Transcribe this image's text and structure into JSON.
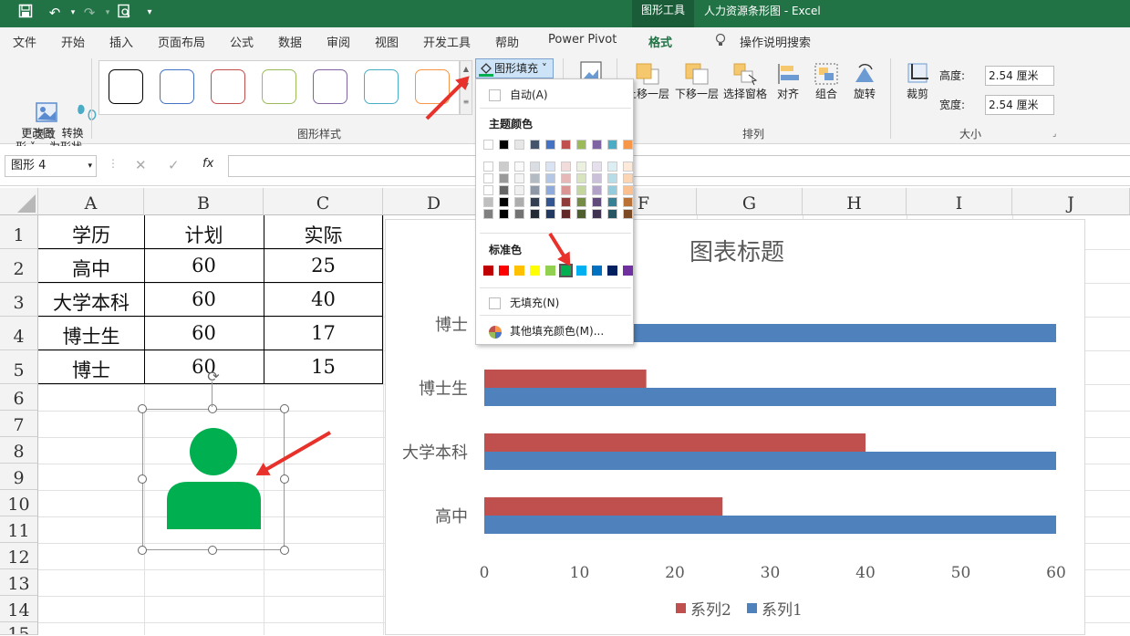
{
  "title_bar": {
    "contextual_tab": "图形工具",
    "document_title": "人力资源条形图 - Excel"
  },
  "menu_tabs": [
    "文件",
    "开始",
    "插入",
    "页面布局",
    "公式",
    "数据",
    "审阅",
    "视图",
    "开发工具",
    "帮助",
    "Power Pivot",
    "格式",
    "操作说明搜索"
  ],
  "ribbon": {
    "change_shape_label": "更改图\n形 ˅",
    "convert_label": "转换\n为形状",
    "group_change": "更改",
    "group_styles": "图形样式",
    "fill_button": "图形填充 ˅",
    "move_forward": "上移一层",
    "move_backward": "下移一层",
    "selection_pane": "选择窗格",
    "align": "对齐",
    "group": "组合",
    "rotate": "旋转",
    "crop": "裁剪",
    "group_arrange": "排列",
    "group_size": "大小",
    "height_label": "高度:",
    "height_value": "2.54 厘米",
    "width_label": "宽度:",
    "width_value": "2.54 厘米",
    "style_swatch_colors": [
      "#000000",
      "#4472c4",
      "#c0504d",
      "#9bbb59",
      "#8064a2",
      "#4bacc6",
      "#f79646"
    ]
  },
  "formula_bar": {
    "name_box": "图形 4",
    "fx": "fx"
  },
  "sheet": {
    "columns": [
      "A",
      "B",
      "C",
      "D",
      "E",
      "F",
      "G",
      "H",
      "I",
      "J"
    ],
    "rows": [
      "1",
      "2",
      "3",
      "4",
      "5",
      "6",
      "7",
      "8",
      "9",
      "10",
      "11",
      "12",
      "13",
      "14",
      "15"
    ],
    "table": [
      [
        "学历",
        "计划",
        "实际"
      ],
      [
        "高中",
        "60",
        "25"
      ],
      [
        "大学本科",
        "60",
        "40"
      ],
      [
        "博士生",
        "60",
        "17"
      ],
      [
        "博士",
        "60",
        "15"
      ]
    ]
  },
  "fill_dropdown": {
    "auto": "自动(A)",
    "theme_colors_title": "主题颜色",
    "theme_colors": [
      "#ffffff",
      "#000000",
      "#e7e6e6",
      "#44546a",
      "#4472c4",
      "#c0504d",
      "#9bbb59",
      "#8064a2",
      "#4bacc6",
      "#f79646"
    ],
    "standard_colors_title": "标准色",
    "standard_colors": [
      "#c00000",
      "#ff0000",
      "#ffc000",
      "#ffff00",
      "#92d050",
      "#00b050",
      "#00b0f0",
      "#0070c0",
      "#002060",
      "#7030a0"
    ],
    "selected_standard_color": "#00b050",
    "no_fill": "无填充(N)",
    "more_colors": "其他填充颜色(M)..."
  },
  "shape": {
    "icon": "person-icon",
    "fill_color": "#00b050"
  },
  "chart_data": {
    "type": "bar",
    "title": "图表标题",
    "categories": [
      "高中",
      "大学本科",
      "博士生",
      "博士"
    ],
    "series": [
      {
        "name": "系列1",
        "color": "#4f81bd",
        "values": [
          60,
          60,
          60,
          60
        ]
      },
      {
        "name": "系列2",
        "color": "#c0504d",
        "values": [
          25,
          40,
          17,
          15
        ]
      }
    ],
    "xlim": [
      0,
      60
    ],
    "ticks": [
      0,
      10,
      20,
      30,
      40,
      50,
      60
    ],
    "legend": "bottom",
    "legend_order": [
      "系列2",
      "系列1"
    ]
  }
}
